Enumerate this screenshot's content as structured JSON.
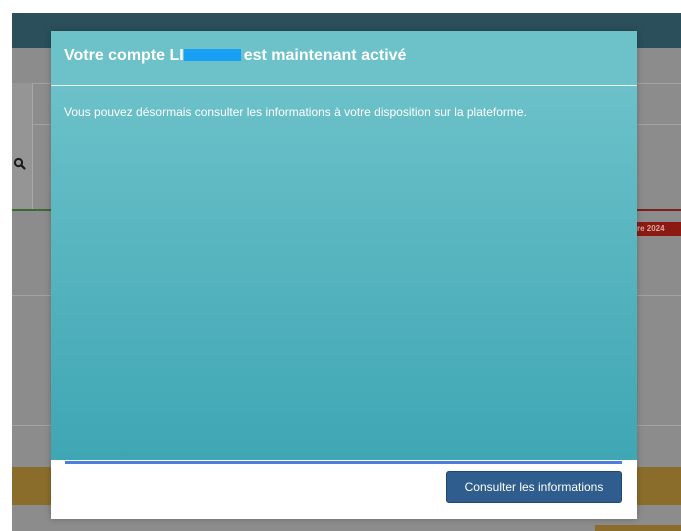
{
  "modal": {
    "title_prefix": "Votre compte LI",
    "title_suffix": "est maintenant activé",
    "message": "Vous pouvez désormais consulter les informations à votre disposition sur la plateforme.",
    "button_label": "Consulter les informations"
  },
  "background": {
    "badge_text": "re 2024"
  },
  "colors": {
    "header": "#6dc1c9",
    "body_bottom": "#3fa6b4",
    "button": "#2f5d8e",
    "progress": "#4a7fe0",
    "redaction": "#18a0f5"
  },
  "icons": {
    "background_search": "search-icon"
  }
}
